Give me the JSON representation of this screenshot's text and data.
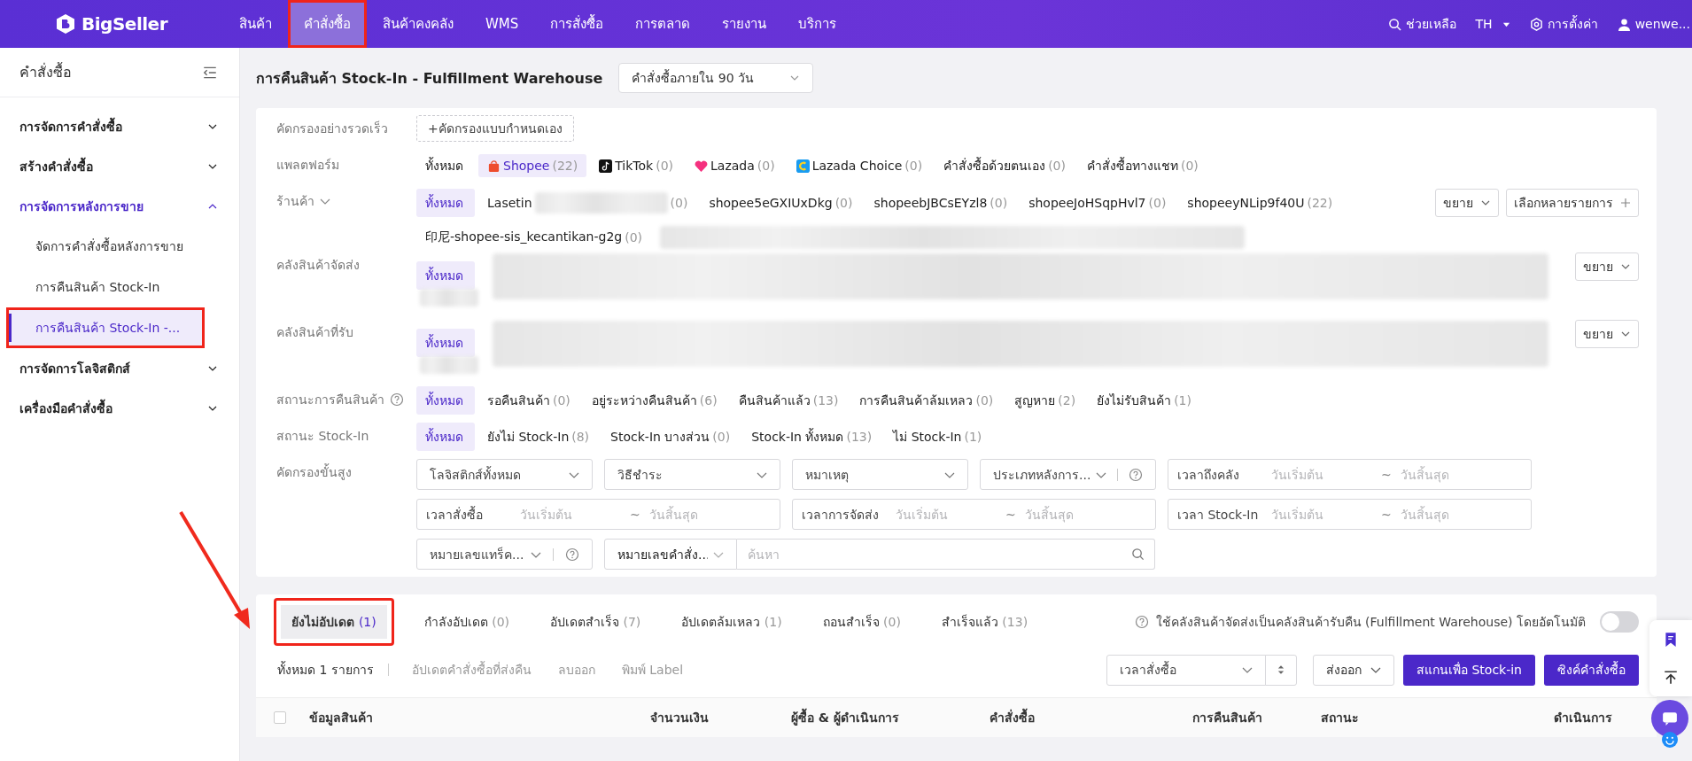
{
  "brand": "BigSeller",
  "nav": [
    {
      "label": "สินค้า",
      "selected": false,
      "highlighted": false
    },
    {
      "label": "คำสั่งซื้อ",
      "selected": true,
      "highlighted": true
    },
    {
      "label": "สินค้าคงคลัง",
      "selected": false,
      "highlighted": false
    },
    {
      "label": "WMS",
      "selected": false,
      "highlighted": false
    },
    {
      "label": "การสั่งซื้อ",
      "selected": false,
      "highlighted": false
    },
    {
      "label": "การตลาด",
      "selected": false,
      "highlighted": false
    },
    {
      "label": "รายงาน",
      "selected": false,
      "highlighted": false
    },
    {
      "label": "บริการ",
      "selected": false,
      "highlighted": false
    }
  ],
  "top_right": {
    "help": "ช่วยเหลือ",
    "language": "TH",
    "settings": "การตั้งค่า",
    "user": "wenwe..."
  },
  "sidebar": {
    "title": "คำสั่งซื้อ",
    "items": [
      {
        "label": "การจัดการคำสั่งซื้อ",
        "expanded": false
      },
      {
        "label": "สร้างคำสั่งซื้อ",
        "expanded": false
      },
      {
        "label": "การจัดการหลังการขาย",
        "expanded": true,
        "children": [
          {
            "label": "จัดการคำสั่งซื้อหลังการขาย",
            "selected": false,
            "highlighted": false
          },
          {
            "label": "การคืนสินค้า Stock-In",
            "selected": false,
            "highlighted": false
          },
          {
            "label": "การคืนสินค้า Stock-In -...",
            "selected": true,
            "highlighted": true
          }
        ]
      },
      {
        "label": "การจัดการโลจิสติกส์",
        "expanded": false
      },
      {
        "label": "เครื่องมือคำสั่งซื้อ",
        "expanded": false
      }
    ]
  },
  "page": {
    "title": "การคืนสินค้า Stock-In - Fulfillment Warehouse",
    "period": "คำสั่งซื้อภายใน 90 วัน"
  },
  "filter_rows": [
    {
      "kind": "quick",
      "label": "คัดกรองอย่างรวดเร็ว",
      "button": "+คัดกรองแบบกำหนดเอง"
    },
    {
      "kind": "chips",
      "label": "แพลตฟอร์ม",
      "lines": [
        [
          {
            "name": "ทั้งหมด",
            "selected": false
          },
          {
            "kind": "bag",
            "name": "Shopee",
            "count": "(22)",
            "selected": true
          },
          {
            "kind": "note",
            "name": "TikTok",
            "count": "(0)",
            "selected": false
          },
          {
            "kind": "heart",
            "name": "Lazada",
            "count": "(0)",
            "selected": false
          },
          {
            "kind": "square",
            "name": "Lazada Choice",
            "count": "(0)",
            "selected": false
          },
          {
            "name": "คำสั่งซื้อด้วยตนเอง",
            "count": "(0)",
            "selected": false
          },
          {
            "name": "คำสั่งซื้อทางแชท",
            "count": "(0)",
            "selected": false
          }
        ]
      ]
    },
    {
      "kind": "chips",
      "label": "ร้านค้า",
      "dropdown": true,
      "expand": "ขยาย",
      "multi": "เลือกหลายรายการ",
      "lines": [
        [
          {
            "name": "ทั้งหมด",
            "selected": true
          },
          {
            "name": "Lasetin",
            "count": "(0)",
            "selected": false,
            "redacted": true
          },
          {
            "name": "shopee5eGXIUxDkg",
            "count": "(0)",
            "selected": false
          },
          {
            "name": "shopeebJBCsEYzl8",
            "count": "(0)",
            "selected": false
          },
          {
            "name": "shopeeJoHSqpHvl7",
            "count": "(0)",
            "selected": false
          },
          {
            "name": "shopeeyNLip9f40U",
            "count": "(22)",
            "selected": false
          }
        ],
        [
          {
            "name": "印尼-shopee-sis_kecantikan-g2g",
            "count": "(0)",
            "selected": false
          },
          {
            "kind": "redacted"
          }
        ]
      ]
    },
    {
      "kind": "chips",
      "label": "คลังสินค้าจัดส่ง",
      "tall": true,
      "expand": "ขยาย",
      "lines": [
        [
          {
            "name": "ทั้งหมด",
            "selected": true
          },
          {
            "kind": "redacted"
          }
        ]
      ]
    },
    {
      "kind": "chips",
      "label": "คลังสินค้าที่รับ",
      "tall": true,
      "expand": "ขยาย",
      "lines": [
        [
          {
            "name": "ทั้งหมด",
            "selected": true
          },
          {
            "kind": "redacted"
          }
        ]
      ]
    },
    {
      "kind": "chips",
      "label": "สถานะการคืนสินค้า",
      "help": true,
      "lines": [
        [
          {
            "name": "ทั้งหมด",
            "selected": true
          },
          {
            "name": "รอคืนสินค้า",
            "count": "(0)",
            "selected": false
          },
          {
            "name": "อยู่ระหว่างคืนสินค้า",
            "count": "(6)",
            "selected": false
          },
          {
            "name": "คืนสินค้าแล้ว",
            "count": "(13)",
            "selected": false
          },
          {
            "name": "การคืนสินค้าล้มเหลว",
            "count": "(0)",
            "selected": false
          },
          {
            "name": "สูญหาย",
            "count": "(2)",
            "selected": false
          },
          {
            "name": "ยังไม่รับสินค้า",
            "count": "(1)",
            "selected": false
          }
        ]
      ]
    },
    {
      "kind": "chips",
      "label": "สถานะ Stock-In",
      "lines": [
        [
          {
            "name": "ทั้งหมด",
            "selected": true
          },
          {
            "name": "ยังไม่ Stock-In",
            "count": "(8)",
            "selected": false
          },
          {
            "name": "Stock-In บางส่วน",
            "count": "(0)",
            "selected": false
          },
          {
            "name": "Stock-In ทั้งหมด",
            "count": "(13)",
            "selected": false
          },
          {
            "name": "ไม่ Stock-In",
            "count": "(1)",
            "selected": false
          }
        ]
      ]
    },
    {
      "kind": "advanced",
      "label": "คัดกรองขั้นสูง",
      "controls": [
        {
          "kind": "select",
          "value": "โลจิสติกส์ทั้งหมด"
        },
        {
          "kind": "select",
          "value": "วิธีชำระ"
        },
        {
          "kind": "select",
          "value": "หมาเหตุ"
        },
        {
          "kind": "select_help",
          "value": "ประเภทหลังการ..."
        },
        {
          "kind": "daterange",
          "label": "เวลาถึงคลัง",
          "start": {
            "placeholder": "วันเริ่มต้น"
          },
          "separator": "~",
          "end": {
            "placeholder": "วันสิ้นสุด"
          }
        },
        {
          "kind": "daterange",
          "label": "เวลาสั่งซื้อ",
          "start": {
            "placeholder": "วันเริ่มต้น"
          },
          "separator": "~",
          "end": {
            "placeholder": "วันสิ้นสุด"
          }
        },
        {
          "kind": "daterange",
          "label": "เวลาการจัดส่ง",
          "start": {
            "placeholder": "วันเริ่มต้น"
          },
          "separator": "~",
          "end": {
            "placeholder": "วันสิ้นสุด"
          }
        },
        {
          "kind": "daterange",
          "label": "เวลา Stock-In",
          "start": {
            "placeholder": "วันเริ่มต้น"
          },
          "separator": "~",
          "end": {
            "placeholder": "วันสิ้นสุด"
          }
        },
        {
          "kind": "select_help",
          "value": "หมายเลขแทร็ค..."
        },
        {
          "kind": "search",
          "value": "หมายเลขคำสั่ง...",
          "placeholder": "ค้นหา"
        }
      ]
    }
  ],
  "tabs": [
    {
      "label": "ยังไม่อัปเดต",
      "count": "(1)",
      "selected": true,
      "highlighted": true
    },
    {
      "label": "กำลังอัปเดต",
      "count": "(0)",
      "selected": false,
      "highlighted": false
    },
    {
      "label": "อัปเดตสำเร็จ",
      "count": "(7)",
      "selected": false,
      "highlighted": false
    },
    {
      "label": "อัปเดตล้มเหลว",
      "count": "(1)",
      "selected": false,
      "highlighted": false
    },
    {
      "label": "ถอนสำเร็จ",
      "count": "(0)",
      "selected": false,
      "highlighted": false
    },
    {
      "label": "สำเร็จแล้ว",
      "count": "(13)",
      "selected": false,
      "highlighted": false
    }
  ],
  "auto_switch": {
    "text": "ใช้คลังสินค้าจัดส่งเป็นคลังสินค้ารับคืน (Fulfillment Warehouse) โดยอัตโนมัติ",
    "on": false
  },
  "actions": {
    "total": "ทั้งหมด 1 รายการ",
    "links": [
      {
        "label": "อัปเดตคำสั่งซื้อที่ส่งคืน",
        "disabled": true
      },
      {
        "label": "ลบออก",
        "disabled": true
      },
      {
        "label": "พิมพ์ Label",
        "disabled": true
      }
    ],
    "sort": "เวลาสั่งซื้อ",
    "export": "ส่งออก",
    "buttons": [
      "สแกนเพื่อ Stock-in",
      "ซิงค์คำสั่งซื้อ"
    ]
  },
  "table": {
    "select_all_checked": false,
    "columns": [
      "ข้อมูลสินค้า",
      "จำนวนเงิน",
      "ผู้ซื้อ & ผู้ดำเนินการ",
      "คำสั่งซื้อ",
      "การคืนสินค้า",
      "สถานะ",
      "ดำเนินการ"
    ]
  }
}
